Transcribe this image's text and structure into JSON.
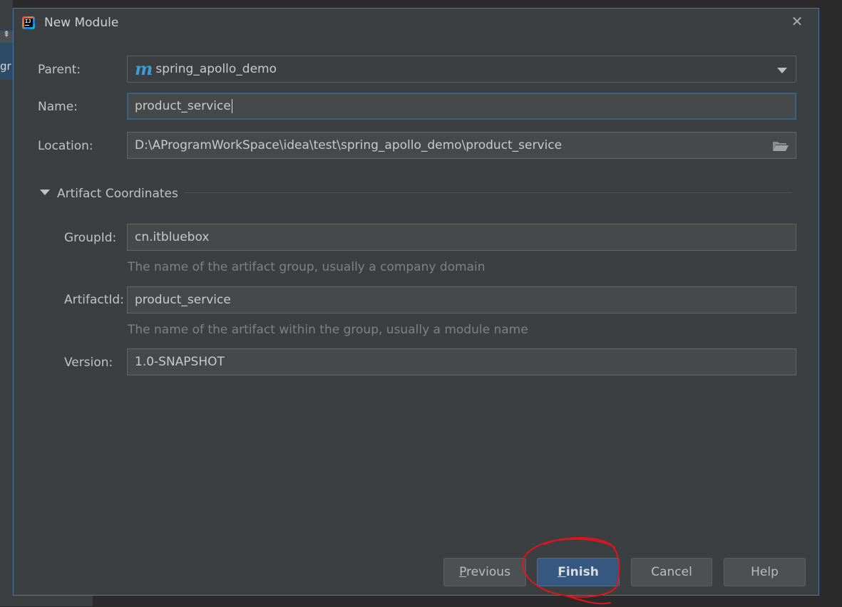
{
  "background": {
    "partial_text": "gr"
  },
  "dialog": {
    "title": "New Module",
    "close_glyph": "✕",
    "app_icon_letters": "IJ"
  },
  "form": {
    "parent": {
      "label": "Parent:",
      "value": "spring_apollo_demo",
      "icon": "maven-icon",
      "icon_glyph": "m"
    },
    "name": {
      "label": "Name:",
      "value": "product_service"
    },
    "location": {
      "label": "Location:",
      "value": "D:\\AProgramWorkSpace\\idea\\test\\spring_apollo_demo\\product_service",
      "icon": "folder-icon"
    }
  },
  "artifact": {
    "section_title": "Artifact Coordinates",
    "group_id": {
      "label": "GroupId:",
      "value": "cn.itbluebox",
      "hint": "The name of the artifact group, usually a company domain"
    },
    "artifact_id": {
      "label": "ArtifactId:",
      "value": "product_service",
      "hint": "The name of the artifact within the group, usually a module name"
    },
    "version": {
      "label": "Version:",
      "value": "1.0-SNAPSHOT"
    }
  },
  "buttons": {
    "previous": {
      "mnemonic": "P",
      "rest": "revious"
    },
    "finish": {
      "mnemonic": "F",
      "rest": "inish"
    },
    "cancel": {
      "label": "Cancel"
    },
    "help": {
      "label": "Help"
    }
  },
  "colors": {
    "dialog_bg": "#3c3f41",
    "field_bg": "#45494a",
    "focus_border": "#3d6185",
    "default_button": "#365880",
    "maven_blue": "#3e9bd6",
    "annotation_red": "#e0141e"
  }
}
